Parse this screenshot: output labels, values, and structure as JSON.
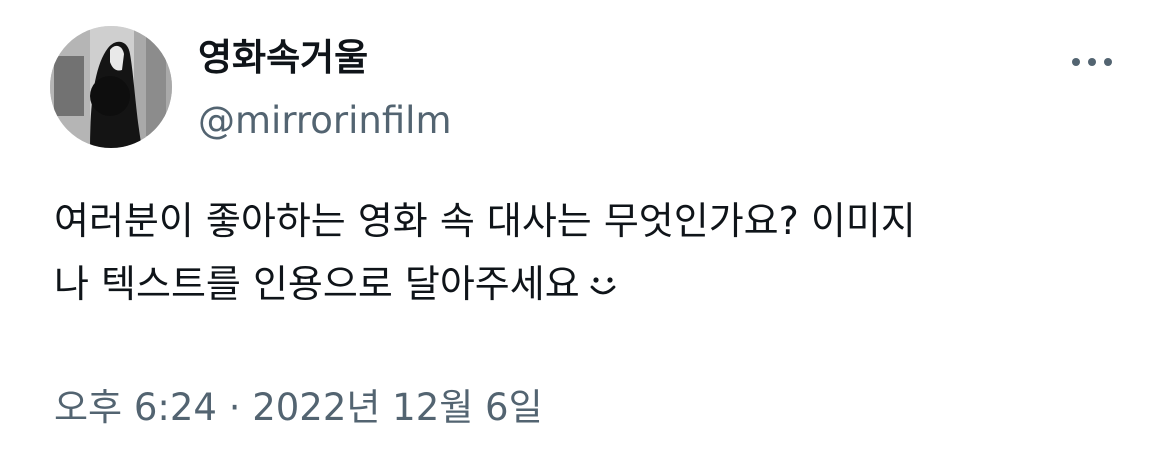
{
  "author": {
    "display_name": "영화속거울",
    "handle": "@mirrorinfilm"
  },
  "tweet": {
    "text_lines": [
      "여러분이 좋아하는 영화 속 대사는 무엇인가요? 이미지",
      "나 텍스트를 인용으로 달아주세요"
    ],
    "emoji": "smile-icon",
    "timestamp": "오후 6:24 · 2022년 12월 6일"
  },
  "icons": {
    "more": "more-options-icon"
  },
  "colors": {
    "primary_text": "#0f1419",
    "secondary_text": "#536471",
    "background": "#ffffff"
  }
}
